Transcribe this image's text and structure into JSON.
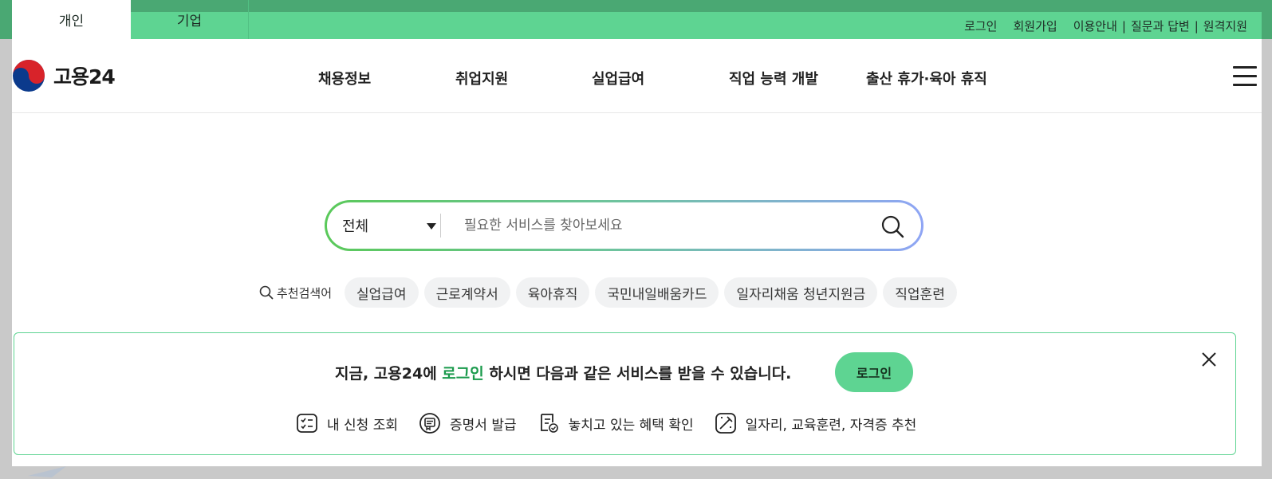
{
  "topbar": {
    "tabs": [
      {
        "label": "개인",
        "active": true
      },
      {
        "label": "기업",
        "active": false
      }
    ],
    "links": [
      "로그인",
      "회원가입"
    ],
    "pipe_links": [
      "이용안내",
      "질문과 답변",
      "원격지원"
    ],
    "pipe_sep": "|"
  },
  "header": {
    "logo_text": "고용24",
    "nav": [
      "채용정보",
      "취업지원",
      "실업급여",
      "직업 능력 개발",
      "출산 휴가·육아 휴직"
    ],
    "menu_icon": "hamburger-icon"
  },
  "search": {
    "scope_value": "전체",
    "placeholder": "필요한 서비스를 찾아보세요",
    "icon": "search-icon"
  },
  "recommended": {
    "label": "추천검색어",
    "keywords": [
      "실업급여",
      "근로계약서",
      "육아휴직",
      "국민내일배움카드",
      "일자리채움 청년지원금",
      "직업훈련"
    ]
  },
  "banner": {
    "msg_before": "지금, 고용24에 ",
    "msg_highlight": "로그인",
    "msg_after": " 하시면 다음과 같은 서비스를 받을 수 있습니다.",
    "login_button": "로그인",
    "services": [
      {
        "label": "내 신청 조회",
        "icon": "checklist-icon"
      },
      {
        "label": "증명서 발급",
        "icon": "certificate-icon"
      },
      {
        "label": "놓치고 있는 혜택 확인",
        "icon": "document-check-icon"
      },
      {
        "label": "일자리, 교육훈련, 자격증 추천",
        "icon": "magic-wand-icon"
      }
    ]
  },
  "colors": {
    "brand_green": "#5ed492",
    "highlight_green": "#1a9a4c",
    "chip_bg": "#f1f2f3"
  }
}
